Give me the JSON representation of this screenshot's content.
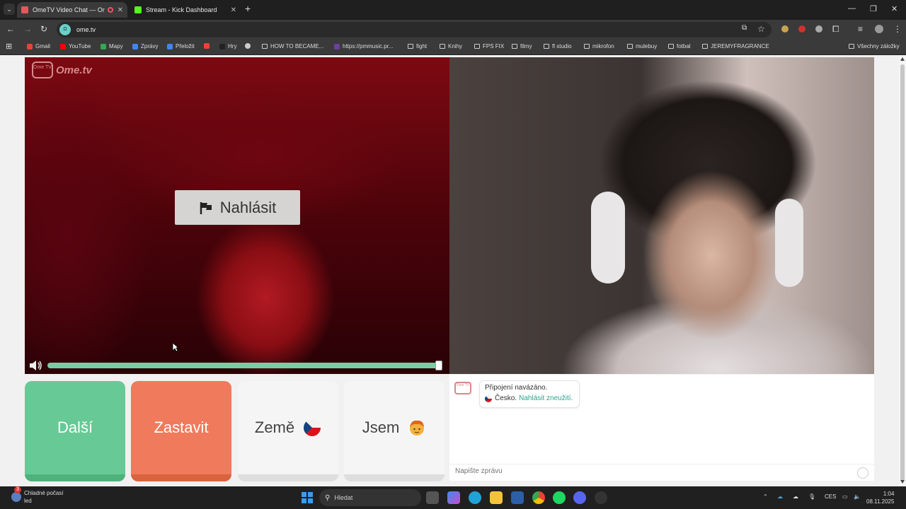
{
  "browser": {
    "tabs": [
      {
        "title": "OmeTV Video Chat — Ome",
        "active": true
      },
      {
        "title": "Stream - Kick Dashboard",
        "active": false
      }
    ],
    "address": "ome.tv",
    "bookmarks": [
      "Gmail",
      "YouTube",
      "Mapy",
      "Zprávy",
      "Přeložit",
      "Hry",
      "HOW TO BECAME...",
      "https://pmmusic.pr...",
      "fight",
      "Knihy",
      "FPS FIX",
      "filmy",
      "fl studio",
      "mikrofon",
      "mulebuy",
      "fotbal",
      "JEREMYFRAGRANCE"
    ],
    "all_bookmarks": "Všechny záložky"
  },
  "app": {
    "logo_small": "Ome TV",
    "logo": "Ome.tv",
    "report_label": "Nahlásit",
    "volume_level": 0.99,
    "buttons": {
      "next": "Další",
      "stop": "Zastavit",
      "country": "Země",
      "gender": "Jsem"
    },
    "chat": {
      "status": "Připojení navázáno.",
      "country": "Česko.",
      "report_link": "Nahlásit zneužití.",
      "placeholder": "Napište zprávu"
    }
  },
  "taskbar": {
    "weather_badge": "3",
    "weather_line1": "Chladné počasí",
    "weather_line2": "led",
    "search": "Hledat",
    "lang": "CES",
    "time": "1:04",
    "date": "08.11.2025"
  },
  "colors": {
    "next": "#67c995",
    "stop": "#ef7a5c",
    "volume": "#76cfa4",
    "link": "#2aa38b"
  }
}
